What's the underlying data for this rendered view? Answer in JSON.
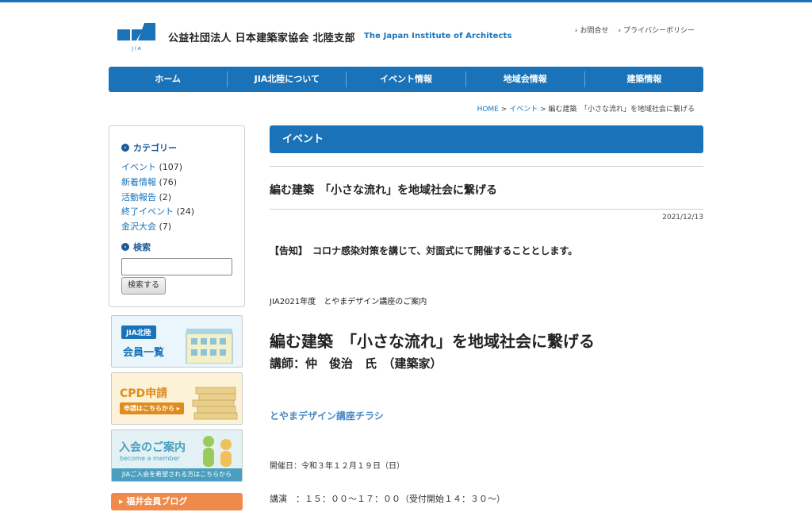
{
  "header": {
    "title": "公益社団法人 日本建築家協会 北陸支部",
    "title_en": "The Japan Institute of Architects",
    "logo_text": "J I A",
    "links": [
      "お問合せ",
      "プライバシーポリシー"
    ]
  },
  "nav": {
    "items": [
      "ホーム",
      "JIA北陸について",
      "イベント情報",
      "地域会情報",
      "建築情報"
    ]
  },
  "breadcrumb": {
    "home": "HOME",
    "sep": ">",
    "section": "イベント",
    "current": "編む建築　「小さな流れ」を地域社会に繋げる"
  },
  "sidebar": {
    "category_heading": "カテゴリー",
    "categories": [
      {
        "label": "イベント",
        "count": "(107)"
      },
      {
        "label": "新着情報",
        "count": "(76)"
      },
      {
        "label": "活動報告",
        "count": "(2)"
      },
      {
        "label": "終了イベント",
        "count": "(24)"
      },
      {
        "label": "金沢大会",
        "count": "(7)"
      }
    ],
    "search_heading": "検索",
    "search_value": "",
    "search_button": "検索する"
  },
  "banners": {
    "member_tag": "JIA北陸",
    "member_title": "会員一覧",
    "cpd_title": "CPD申請",
    "cpd_tag": "申請はこちらから ▸",
    "join_title": "入会のご案内",
    "join_sub": "become a member",
    "join_bar": "JIAご入会を希望される方はこちらから",
    "fukui": "福井会員ブログ"
  },
  "main": {
    "page_heading": "イベント",
    "post_title": "編む建築　「小さな流れ」を地域社会に繋げる",
    "date": "2021/12/13",
    "notice": "【告知】　コロナ感染対策を講じて、対面式にて開催することとします。",
    "small_heading": "JIA2021年度　とやまデザイン講座のご案内",
    "big_title": "編む建築　「小さな流れ」を地域社会に繋げる",
    "lecturer": "講師：仲　俊治　氏　（建築家）",
    "flyer_link": "とやまデザイン講座チラシ",
    "date_line": "開催日：令和３年１２月１９日（日）",
    "time_line": "講演　：１５：００～１７：００（受付開始１４：３０～）"
  },
  "colors": {
    "primary": "#1a73b8",
    "accent_orange": "#f08a4b",
    "cpd_orange": "#e08c1c"
  }
}
